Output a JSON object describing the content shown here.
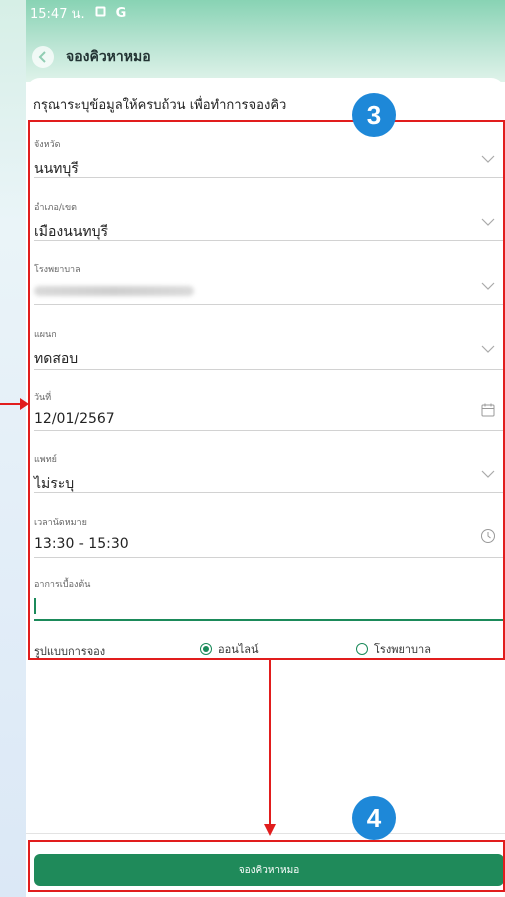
{
  "status_bar": {
    "time": "15:47 น.",
    "icons": [
      "image-icon",
      "google-g-icon"
    ]
  },
  "header": {
    "title": "จองคิวหาหมอ"
  },
  "instruction": "กรุณาระบุข้อมูลให้ครบถ้วน เพื่อทำการจองคิว",
  "fields": {
    "province": {
      "label": "จังหวัด",
      "value": "นนทบุรี"
    },
    "district": {
      "label": "อำเภอ/เขต",
      "value": "เมืองนนทบุรี"
    },
    "hospital": {
      "label": "โรงพยาบาล"
    },
    "department": {
      "label": "แผนก",
      "value": "ทดสอบ"
    },
    "date": {
      "label": "วันที่",
      "value": "12/01/2567"
    },
    "doctor": {
      "label": "แพทย์",
      "value": "ไม่ระบุ"
    },
    "appointment_time": {
      "label": "เวลานัดหมาย",
      "value": "13:30 - 15:30"
    },
    "initial_symptoms": {
      "label": "อาการเบื้องต้น",
      "value": ""
    }
  },
  "booking_type": {
    "label": "รูปแบบการจอง",
    "options": [
      {
        "label": "ออนไลน์",
        "selected": true
      },
      {
        "label": "โรงพยาบาล",
        "selected": false
      }
    ]
  },
  "book_button": "จองคิวหาหมอ",
  "annotations": {
    "step_form": "3",
    "step_button": "4"
  },
  "colors": {
    "primary_green": "#1f8a5a",
    "annotation_red": "#e11d1d",
    "annotation_blue": "#1e88d8"
  }
}
